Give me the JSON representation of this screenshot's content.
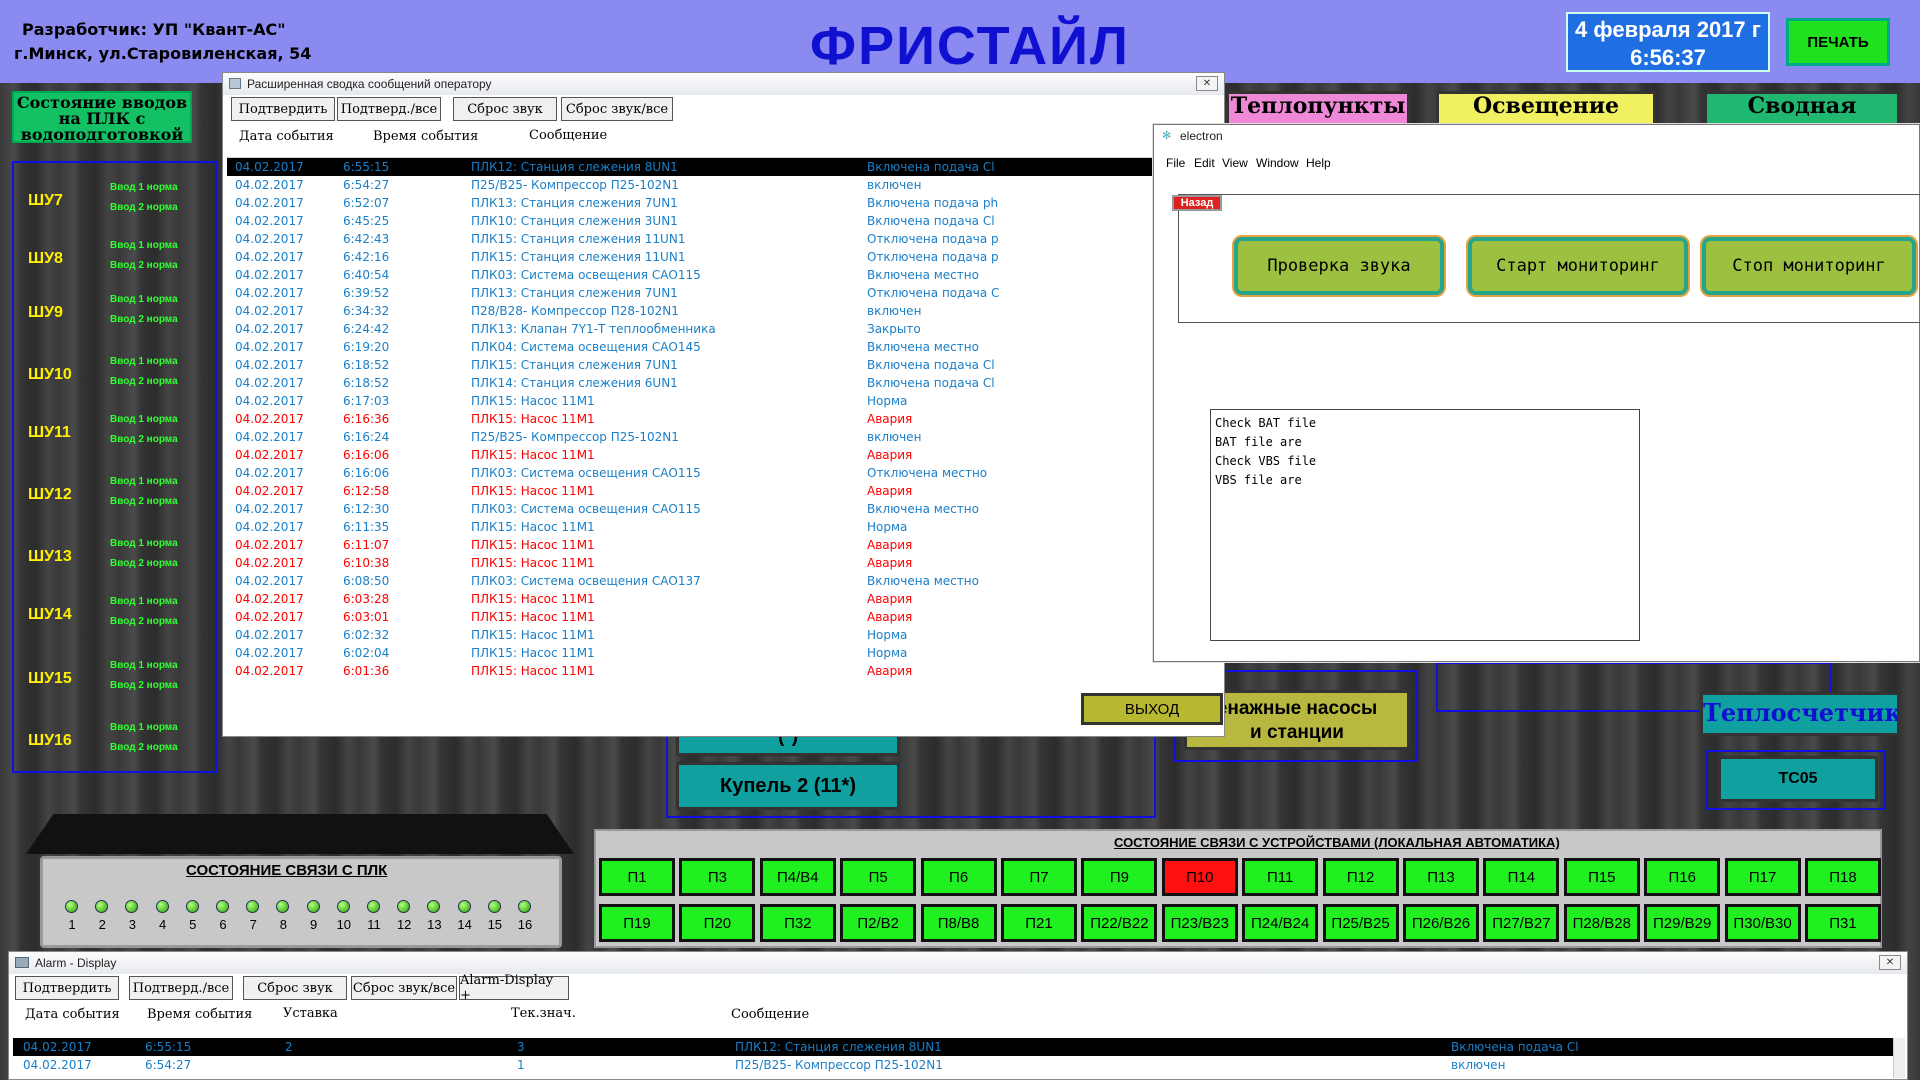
{
  "header": {
    "developer_line1": "Разработчик: УП \"Квант-АС\"",
    "developer_line2": "г.Минск, ул.Старовиленская, 54",
    "title": "ФРИСТАЙЛ",
    "date": "4 февраля 2017 г",
    "time": "6:56:37",
    "print_label": "ПЕЧАТЬ"
  },
  "left_panel": {
    "title": "Состояние вводов на ПЛК с водоподготовкой",
    "items": [
      {
        "name": "ШУ7",
        "input1": "Ввод 1 норма",
        "input2": "Ввод 2 норма"
      },
      {
        "name": "ШУ8",
        "input1": "Ввод 1 норма",
        "input2": "Ввод 2 норма"
      },
      {
        "name": "ШУ9",
        "input1": "Ввод 1 норма",
        "input2": "Ввод 2 норма"
      },
      {
        "name": "ШУ10",
        "input1": "Ввод 1 норма",
        "input2": "Ввод 2 норма"
      },
      {
        "name": "ШУ11",
        "input1": "Ввод 1 норма",
        "input2": "Ввод 2 норма"
      },
      {
        "name": "ШУ12",
        "input1": "Ввод 1 норма",
        "input2": "Ввод 2 норма"
      },
      {
        "name": "ШУ13",
        "input1": "Ввод 1 норма",
        "input2": "Ввод 2 норма"
      },
      {
        "name": "ШУ14",
        "input1": "Ввод 1 норма",
        "input2": "Ввод 2 норма"
      },
      {
        "name": "ШУ15",
        "input1": "Ввод 1 норма",
        "input2": "Ввод 2 норма"
      },
      {
        "name": "ШУ16",
        "input1": "Ввод 1 норма",
        "input2": "Ввод 2 норма"
      }
    ]
  },
  "tiles": {
    "teplopunkty": "Теплопункты",
    "osveshenie": "Освещение",
    "svodnaya": "Сводная",
    "drain_line1": "енажные насосы",
    "drain_line2": "и станции",
    "teploschetchiki": "Теплосчетчики",
    "tc05": "ТС05",
    "kupel2": "Купель 2 (11*)",
    "kupel1_partial": "(*)"
  },
  "plc_status": {
    "title": "СОСТОЯНИЕ СВЯЗИ С ПЛК",
    "numbers": [
      "1",
      "2",
      "3",
      "4",
      "5",
      "6",
      "7",
      "8",
      "9",
      "10",
      "11",
      "12",
      "13",
      "14",
      "15",
      "16"
    ]
  },
  "devices": {
    "title": "СОСТОЯНИЕ СВЯЗИ С УСТРОЙСТВАМИ (ЛОКАЛЬНАЯ АВТОМАТИКА)",
    "row1": [
      {
        "label": "П1",
        "alarm": false
      },
      {
        "label": "П3",
        "alarm": false
      },
      {
        "label": "П4/В4",
        "alarm": false
      },
      {
        "label": "П5",
        "alarm": false
      },
      {
        "label": "П6",
        "alarm": false
      },
      {
        "label": "П7",
        "alarm": false
      },
      {
        "label": "П9",
        "alarm": false
      },
      {
        "label": "П10",
        "alarm": true
      },
      {
        "label": "П11",
        "alarm": false
      },
      {
        "label": "П12",
        "alarm": false
      },
      {
        "label": "П13",
        "alarm": false
      },
      {
        "label": "П14",
        "alarm": false
      },
      {
        "label": "П15",
        "alarm": false
      },
      {
        "label": "П16",
        "alarm": false
      },
      {
        "label": "П17",
        "alarm": false
      },
      {
        "label": "П18",
        "alarm": false
      }
    ],
    "row2": [
      {
        "label": "П19",
        "alarm": false
      },
      {
        "label": "П20",
        "alarm": false
      },
      {
        "label": "П32",
        "alarm": false
      },
      {
        "label": "П2/В2",
        "alarm": false
      },
      {
        "label": "П8/В8",
        "alarm": false
      },
      {
        "label": "П21",
        "alarm": false
      },
      {
        "label": "П22/В22",
        "alarm": false
      },
      {
        "label": "П23/В23",
        "alarm": false
      },
      {
        "label": "П24/В24",
        "alarm": false
      },
      {
        "label": "П25/В25",
        "alarm": false
      },
      {
        "label": "П26/В26",
        "alarm": false
      },
      {
        "label": "П27/В27",
        "alarm": false
      },
      {
        "label": "П28/В28",
        "alarm": false
      },
      {
        "label": "П29/В29",
        "alarm": false
      },
      {
        "label": "П30/В30",
        "alarm": false
      },
      {
        "label": "П31",
        "alarm": false
      }
    ]
  },
  "messages_window": {
    "title": "Расширенная сводка сообщений оператору",
    "buttons": [
      "Подтвердить",
      "Подтверд./все",
      "Сброс звук",
      "Сброс звук/все"
    ],
    "columns": [
      "Дата события",
      "Время события",
      "Сообщение"
    ],
    "exit_label": "ВЫХОД",
    "rows": [
      {
        "date": "04.02.2017",
        "time": "6:55:15",
        "msg": "ПЛК12: Станция слежения 8UN1",
        "state": "Включена подача Cl",
        "type": "selected"
      },
      {
        "date": "04.02.2017",
        "time": "6:54:27",
        "msg": "П25/В25- Компрессор П25-102N1",
        "state": "включен",
        "type": "normal"
      },
      {
        "date": "04.02.2017",
        "time": "6:52:07",
        "msg": "ПЛК13: Станция слежения 7UN1",
        "state": "Включена подача ph",
        "type": "normal"
      },
      {
        "date": "04.02.2017",
        "time": "6:45:25",
        "msg": "ПЛК10: Станция слежения 3UN1",
        "state": "Включена подача Cl",
        "type": "normal"
      },
      {
        "date": "04.02.2017",
        "time": "6:42:43",
        "msg": "ПЛК15: Станция слежения 11UN1",
        "state": "Отключена подача p",
        "type": "normal"
      },
      {
        "date": "04.02.2017",
        "time": "6:42:16",
        "msg": "ПЛК15: Станция слежения 11UN1",
        "state": "Отключена подача p",
        "type": "normal"
      },
      {
        "date": "04.02.2017",
        "time": "6:40:54",
        "msg": "ПЛК03: Система освещения САО115",
        "state": "Включена местно",
        "type": "normal"
      },
      {
        "date": "04.02.2017",
        "time": "6:39:52",
        "msg": "ПЛК13: Станция слежения 7UN1",
        "state": "Отключена подача C",
        "type": "normal"
      },
      {
        "date": "04.02.2017",
        "time": "6:34:32",
        "msg": "П28/В28- Компрессор П28-102N1",
        "state": "включен",
        "type": "normal"
      },
      {
        "date": "04.02.2017",
        "time": "6:24:42",
        "msg": "ПЛК13: Клапан 7Y1-Т теплообменника",
        "state": "Закрыто",
        "type": "normal"
      },
      {
        "date": "04.02.2017",
        "time": "6:19:20",
        "msg": "ПЛК04: Система освещения САО145",
        "state": "Включена местно",
        "type": "normal"
      },
      {
        "date": "04.02.2017",
        "time": "6:18:52",
        "msg": "ПЛК15: Станция слежения 7UN1",
        "state": "Включена подача Cl",
        "type": "normal"
      },
      {
        "date": "04.02.2017",
        "time": "6:18:52",
        "msg": "ПЛК14: Станция слежения 6UN1",
        "state": "Включена подача Cl",
        "type": "normal"
      },
      {
        "date": "04.02.2017",
        "time": "6:17:03",
        "msg": "ПЛК15: Насос 11М1",
        "state": "Норма",
        "type": "normal"
      },
      {
        "date": "04.02.2017",
        "time": "6:16:36",
        "msg": "ПЛК15: Насос 11М1",
        "state": "Авария",
        "type": "alarm"
      },
      {
        "date": "04.02.2017",
        "time": "6:16:24",
        "msg": "П25/В25- Компрессор П25-102N1",
        "state": "включен",
        "type": "normal"
      },
      {
        "date": "04.02.2017",
        "time": "6:16:06",
        "msg": "ПЛК15: Насос 11М1",
        "state": "Авария",
        "type": "alarm"
      },
      {
        "date": "04.02.2017",
        "time": "6:16:06",
        "msg": "ПЛК03: Система освещения САО115",
        "state": "Отключена местно",
        "type": "normal"
      },
      {
        "date": "04.02.2017",
        "time": "6:12:58",
        "msg": "ПЛК15: Насос 11М1",
        "state": "Авария",
        "type": "alarm"
      },
      {
        "date": "04.02.2017",
        "time": "6:12:30",
        "msg": "ПЛК03: Система освещения САО115",
        "state": "Включена местно",
        "type": "normal"
      },
      {
        "date": "04.02.2017",
        "time": "6:11:35",
        "msg": "ПЛК15: Насос 11М1",
        "state": "Норма",
        "type": "normal"
      },
      {
        "date": "04.02.2017",
        "time": "6:11:07",
        "msg": "ПЛК15: Насос 11М1",
        "state": "Авария",
        "type": "alarm"
      },
      {
        "date": "04.02.2017",
        "time": "6:10:38",
        "msg": "ПЛК15: Насос 11М1",
        "state": "Авария",
        "type": "alarm"
      },
      {
        "date": "04.02.2017",
        "time": "6:08:50",
        "msg": "ПЛК03: Система освещения САО137",
        "state": "Включена местно",
        "type": "normal"
      },
      {
        "date": "04.02.2017",
        "time": "6:03:28",
        "msg": "ПЛК15: Насос 11М1",
        "state": "Авария",
        "type": "alarm"
      },
      {
        "date": "04.02.2017",
        "time": "6:03:01",
        "msg": "ПЛК15: Насос 11М1",
        "state": "Авария",
        "type": "alarm"
      },
      {
        "date": "04.02.2017",
        "time": "6:02:32",
        "msg": "ПЛК15: Насос 11М1",
        "state": "Норма",
        "type": "normal"
      },
      {
        "date": "04.02.2017",
        "time": "6:02:04",
        "msg": "ПЛК15: Насос 11М1",
        "state": "Норма",
        "type": "normal"
      },
      {
        "date": "04.02.2017",
        "time": "6:01:36",
        "msg": "ПЛК15: Насос 11М1",
        "state": "Авария",
        "type": "alarm"
      }
    ]
  },
  "electron_window": {
    "title": "electron",
    "menu": [
      "File",
      "Edit",
      "View",
      "Window",
      "Help"
    ],
    "back_label": "Назад",
    "buttons": [
      "Проверка звука",
      "Старт мониторинг",
      "Стоп мониторинг"
    ],
    "log_lines": [
      "Check BAT file",
      "BAT file are",
      "Check VBS file",
      "VBS file are"
    ]
  },
  "alarm_window": {
    "title": "Alarm - Display",
    "buttons": [
      "Подтвердить",
      "Подтверд./все",
      "Сброс звук",
      "Сброс звук/все",
      "Alarm-Display +"
    ],
    "columns": [
      "Дата события",
      "Время события",
      "Уставка",
      "Тек.знач.",
      "Сообщение"
    ],
    "rows": [
      {
        "date": "04.02.2017",
        "time": "6:55:15",
        "setpoint": "2",
        "value": "3",
        "msg": "ПЛК12: Станция слежения 8UN1",
        "state": "Включена подача Cl",
        "selected": true
      },
      {
        "date": "04.02.2017",
        "time": "6:54:27",
        "setpoint": "",
        "value": "1",
        "msg": "П25/В25- Компрессор П25-102N1",
        "state": "включен",
        "selected": false
      }
    ]
  },
  "colors": {
    "header_bg": "#8a8af0",
    "title_blue": "#1010d0",
    "ok_green": "#20f020",
    "alarm_red": "#ff1010",
    "row_blue": "#1a7fc8",
    "row_red": "#ff0000",
    "electron_btn": "#9ec040",
    "electron_border": "#25a58a"
  }
}
